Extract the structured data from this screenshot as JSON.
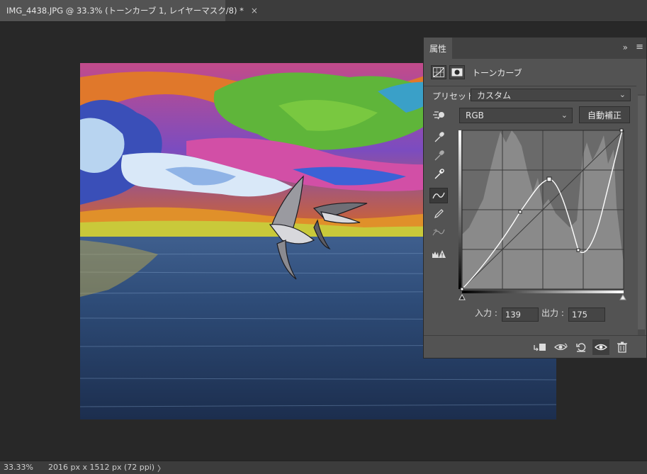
{
  "document": {
    "tab_title": "IMG_4438.JPG @ 33.3% (トーンカーブ 1, レイヤーマスク/8) *",
    "close_glyph": "×"
  },
  "status": {
    "zoom": "33.33%",
    "doc_info": "2016 px x 1512 px (72 ppi)",
    "arrow": "〉"
  },
  "panel": {
    "tab_label": "属性",
    "collapse_glyph": "»",
    "menu_glyph": "≡",
    "adjustment_title": "トーンカーブ",
    "preset_label": "プリセット :",
    "preset_value": "カスタム",
    "channel_value": "RGB",
    "auto_button": "自動補正",
    "input_label": "入力 :",
    "input_value": "139",
    "output_label": "出力 :",
    "output_value": "175"
  },
  "icons": {
    "tools": [
      "target-adjust-icon",
      "black-eyedropper-icon",
      "gray-eyedropper-icon",
      "white-eyedropper-icon",
      "curve-point-icon",
      "pencil-icon",
      "smooth-curve-icon",
      "clipping-warning-icon"
    ],
    "bottom": [
      "clip-to-layer-icon",
      "view-previous-icon",
      "reset-icon",
      "visibility-icon",
      "trash-icon"
    ]
  }
}
